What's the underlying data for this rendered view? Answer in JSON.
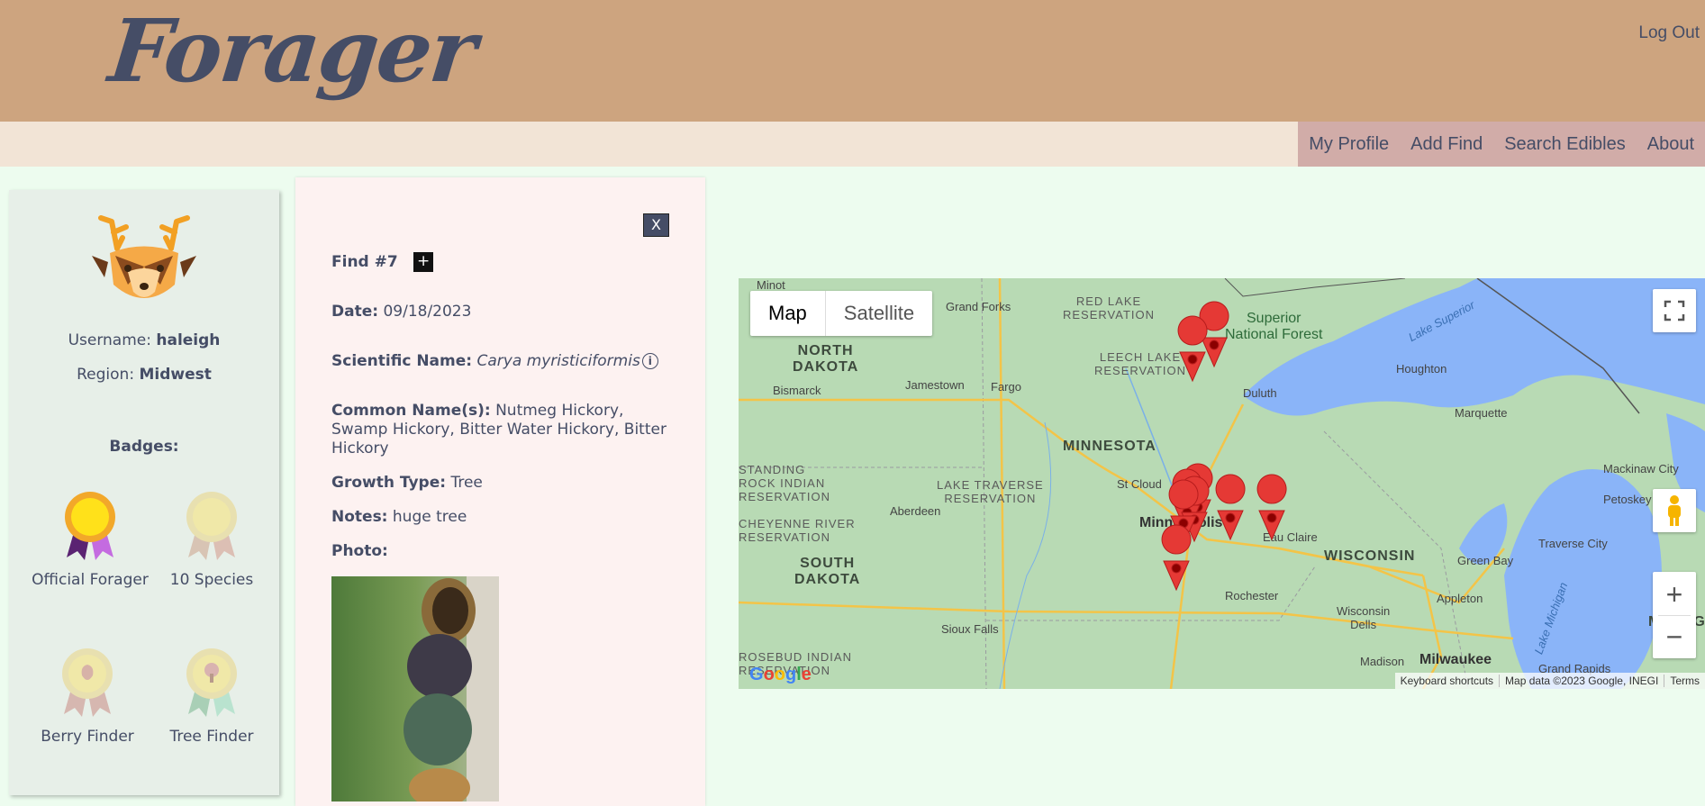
{
  "header": {
    "logo": "Forager",
    "logout": "Log Out"
  },
  "nav": {
    "items": [
      "My Profile",
      "Add Find",
      "Search Edibles",
      "About"
    ]
  },
  "profile": {
    "username_label": "Username:",
    "username": "haleigh",
    "region_label": "Region:",
    "region": "Midwest",
    "badges_title": "Badges:",
    "badges": [
      {
        "label": "Official Forager",
        "earned": true
      },
      {
        "label": "10 Species",
        "earned": false
      },
      {
        "label": "Berry Finder",
        "earned": false
      },
      {
        "label": "Tree Finder",
        "earned": false
      }
    ]
  },
  "find": {
    "close_label": "X",
    "title": "Find #7",
    "add_label": "+",
    "date_label": "Date:",
    "date": "09/18/2023",
    "sci_label": "Scientific Name:",
    "sci_name": "Carya myristiciformis",
    "info_glyph": "i",
    "common_label": "Common Name(s):",
    "common_names": "Nutmeg Hickory, Swamp Hickory, Bitter Water Hickory, Bitter Hickory",
    "growth_label": "Growth Type:",
    "growth_type": "Tree",
    "notes_label": "Notes:",
    "notes": "huge tree",
    "photo_label": "Photo:"
  },
  "map": {
    "type_map": "Map",
    "type_satellite": "Satellite",
    "zoom_in": "+",
    "zoom_out": "−",
    "labels": {
      "minot": "Minot",
      "grand_forks": "Grand Forks",
      "red_lake": "RED LAKE\nRESERVATION",
      "superior_nf": "Superior\nNational Forest",
      "lake_superior": "Lake Superior",
      "north_dakota": "NORTH\nDAKOTA",
      "leech_lake": "LEECH LAKE\nRESERVATION",
      "houghton": "Houghton",
      "bismarck": "Bismarck",
      "jamestown": "Jamestown",
      "fargo": "Fargo",
      "duluth": "Duluth",
      "marquette": "Marquette",
      "minnesota": "MINNESOTA",
      "standing_rock": "STANDING\nROCK INDIAN\nRESERVATION",
      "lake_traverse": "LAKE TRAVERSE\nRESERVATION",
      "st_cloud": "St Cloud",
      "mackinaw": "Mackinaw City",
      "petoskey": "Petoskey",
      "aberdeen": "Aberdeen",
      "cheyenne": "CHEYENNE RIVER\nRESERVATION",
      "minneapolis": "Minneapolis",
      "eau_claire": "Eau Claire",
      "wisconsin": "WISCONSIN",
      "green_bay": "Green Bay",
      "traverse_city": "Traverse City",
      "south_dakota": "SOUTH\nDAKOTA",
      "rochester": "Rochester",
      "appleton": "Appleton",
      "lake_michigan": "Lake Michigan",
      "michigan": "MICHIGA",
      "wisconsin_dells": "Wisconsin\nDells",
      "sioux_falls": "Sioux Falls",
      "rosebud": "ROSEBUD INDIAN\nRESERVATION",
      "madison": "Madison",
      "milwaukee": "Milwaukee",
      "grand_rapids": "Grand Rapids"
    },
    "footer": [
      "Keyboard shortcuts",
      "Map data ©2023 Google, INEGI",
      "Terms"
    ],
    "google": "Google",
    "pin_color": "#e53935"
  }
}
